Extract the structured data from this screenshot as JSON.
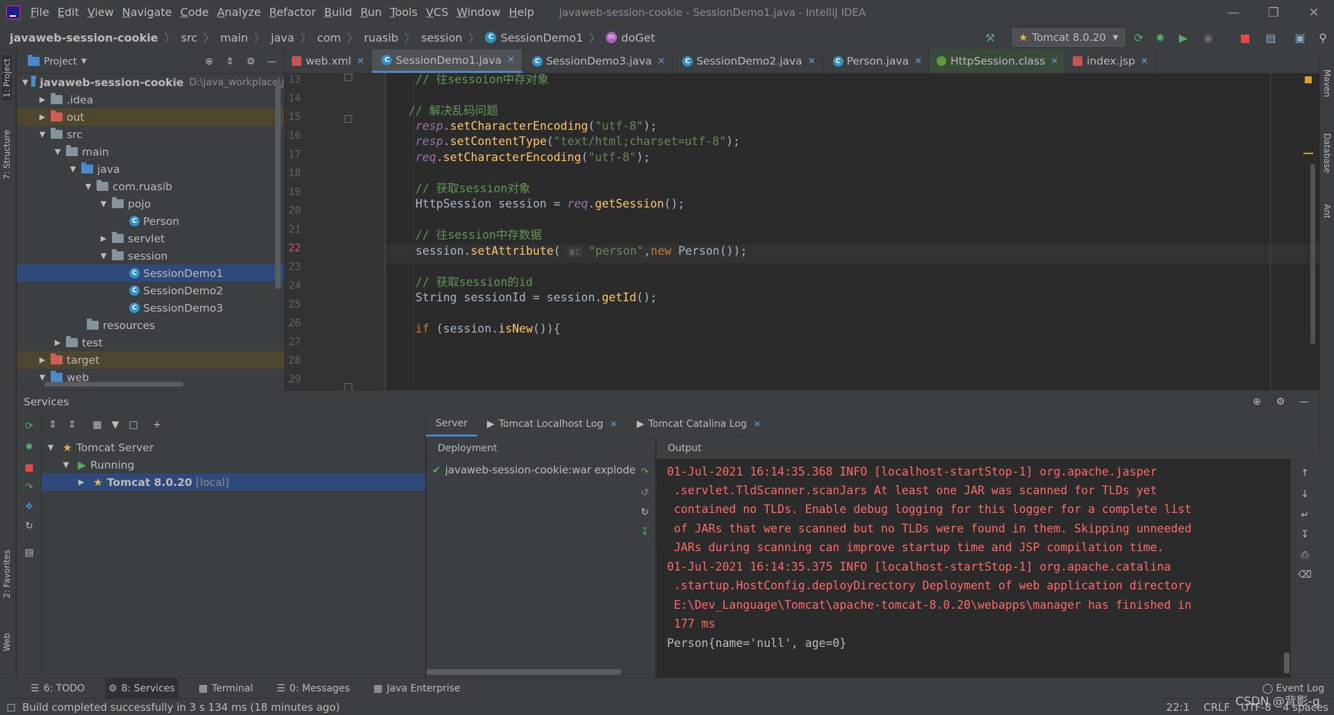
{
  "menubar": {
    "items": [
      "File",
      "Edit",
      "View",
      "Navigate",
      "Code",
      "Analyze",
      "Refactor",
      "Build",
      "Run",
      "Tools",
      "VCS",
      "Window",
      "Help"
    ],
    "window_title": "javaweb-session-cookie - SessionDemo1.java - IntelliJ IDEA"
  },
  "breadcrumb": [
    "javaweb-session-cookie",
    "src",
    "main",
    "java",
    "com",
    "ruasib",
    "session",
    "SessionDemo1",
    "doGet"
  ],
  "run_config": "Tomcat 8.0.20",
  "project_panel": {
    "title": "Project",
    "root": "javaweb-session-cookie",
    "root_path": "D:\\java_workplace\\j",
    "nodes": [
      ".idea",
      "out",
      "src",
      "main",
      "java",
      "com.ruasib",
      "pojo",
      "Person",
      "servlet",
      "session",
      "SessionDemo1",
      "SessionDemo2",
      "SessionDemo3",
      "resources",
      "test",
      "target",
      "web"
    ]
  },
  "editor_tabs": [
    "web.xml",
    "SessionDemo1.java",
    "SessionDemo3.java",
    "SessionDemo2.java",
    "Person.java",
    "HttpSession.class",
    "index.jsp"
  ],
  "code": {
    "line_numbers": [
      "13",
      "14",
      "15",
      "16",
      "17",
      "18",
      "19",
      "20",
      "21",
      "22",
      "23",
      "24",
      "25",
      "26",
      "27",
      "28",
      "29"
    ],
    "c13": "// 往sessoion中存对象",
    "c15": "// 解决乱码问题",
    "c16a": "resp",
    "c16b": ".",
    "c16c": "setCharacterEncoding",
    "c16d": "(",
    "c16e": "\"utf-8\"",
    "c16f": ");",
    "c17a": "resp",
    "c17c": "setContentType",
    "c17e": "\"text/html;charset=utf-8\"",
    "c18a": "req",
    "c18c": "setCharacterEncoding",
    "c18e": "\"utf-8\"",
    "c20": "// 获取session对象",
    "c21a": "HttpSession session = ",
    "c21b": "req",
    "c21c": ".",
    "c21d": "getSession",
    "c21e": "();",
    "c23": "// 往session中存数据",
    "c24a": "session.",
    "c24b": "setAttribute",
    "c24c": "( ",
    "c24hint": "s:",
    "c24d": "\"person\"",
    "c24e": ",",
    "c24f": "new",
    "c24g": " Person());",
    "c26": "// 获取session的id",
    "c27a": "String sessionId = session.",
    "c27b": "getId",
    "c27c": "();",
    "c29a": "if",
    "c29b": " (session.",
    "c29c": "isNew",
    "c29d": "()){"
  },
  "services": {
    "title": "Services",
    "tree": [
      "Tomcat Server",
      "Running",
      "Tomcat 8.0.20"
    ],
    "tree_suffix": "[local]",
    "tabs": [
      "Server",
      "Tomcat Localhost Log",
      "Tomcat Catalina Log"
    ],
    "deployment_header": "Deployment",
    "deployment_item": "javaweb-session-cookie:war explode",
    "output_header": "Output",
    "output_lines": [
      "01-Jul-2021 16:14:35.368 INFO [localhost-startStop-1] org.apache.jasper",
      " .servlet.TldScanner.scanJars At least one JAR was scanned for TLDs yet",
      " contained no TLDs. Enable debug logging for this logger for a complete list",
      " of JARs that were scanned but no TLDs were found in them. Skipping unneeded",
      " JARs during scanning can improve startup time and JSP compilation time.",
      "01-Jul-2021 16:14:35.375 INFO [localhost-startStop-1] org.apache.catalina",
      " .startup.HostConfig.deployDirectory Deployment of web application directory",
      " E:\\Dev_Language\\Tomcat\\apache-tomcat-8.0.20\\webapps\\manager has finished in",
      " 177 ms",
      "Person{name='null', age=0}"
    ]
  },
  "tool_windows": [
    "6: TODO",
    "8: Services",
    "Terminal",
    "0: Messages",
    "Java Enterprise"
  ],
  "event_log": "Event Log",
  "status": {
    "message": "Build completed successfully in 3 s 134 ms (18 minutes ago)",
    "position": "22:1",
    "line_sep": "CRLF",
    "encoding": "UTF-8",
    "indent": "4 spaces",
    "watermark": "CSDN @背影-g"
  },
  "side_tabs": {
    "left": [
      "1: Project",
      "7: Structure",
      "2: Favorites",
      "Web"
    ],
    "right": [
      "Maven",
      "Database",
      "Ant"
    ]
  }
}
